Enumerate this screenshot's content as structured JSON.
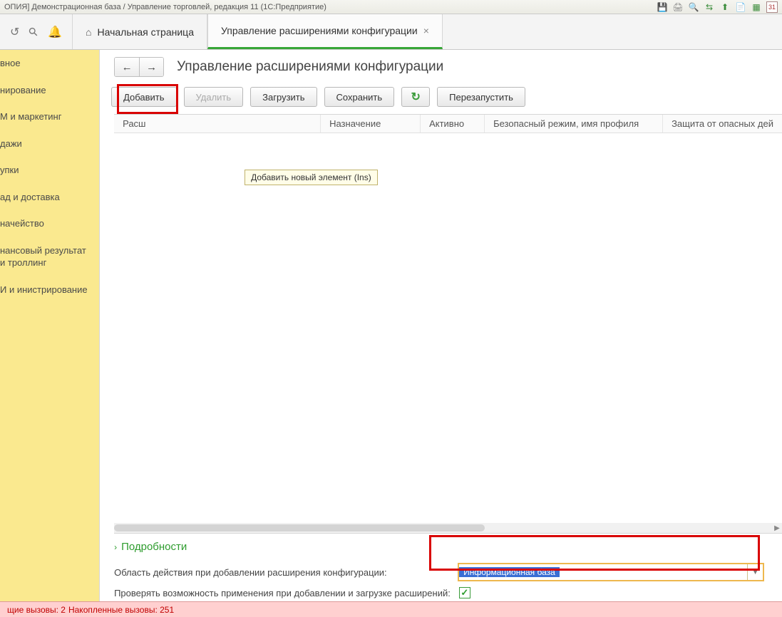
{
  "title": "ОПИЯ] Демонстрационная база / Управление торговлей, редакция 11  (1С:Предприятие)",
  "tabs": {
    "home": "Начальная страница",
    "active": "Управление расширениями конфигурации"
  },
  "sidebar": {
    "items": [
      "вное",
      "нирование",
      "М и маркетинг",
      "дажи",
      "упки",
      "ад и доставка",
      "начейство",
      "нансовый результат и троллинг",
      "И и инистрирование"
    ]
  },
  "page": {
    "title": "Управление расширениями конфигурации"
  },
  "toolbar": {
    "add": "Добавить",
    "delete": "Удалить",
    "load": "Загрузить",
    "save": "Сохранить",
    "restart": "Перезапустить"
  },
  "tooltip": "Добавить новый элемент (Ins)",
  "table": {
    "headers": {
      "ext": "Расш",
      "purpose": "Назначение",
      "active": "Активно",
      "safemode": "Безопасный режим, имя профиля",
      "protect": "Защита от опасных дей"
    }
  },
  "details": {
    "label": "Подробности"
  },
  "form": {
    "scope_label": "Область действия при добавлении расширения конфигурации:",
    "scope_value": "Информационная база",
    "check_label": "Проверять возможность применения при добавлении и загрузке расширений:"
  },
  "status": {
    "current": "щие вызовы: 2",
    "accum": "Накопленные вызовы: 251"
  }
}
